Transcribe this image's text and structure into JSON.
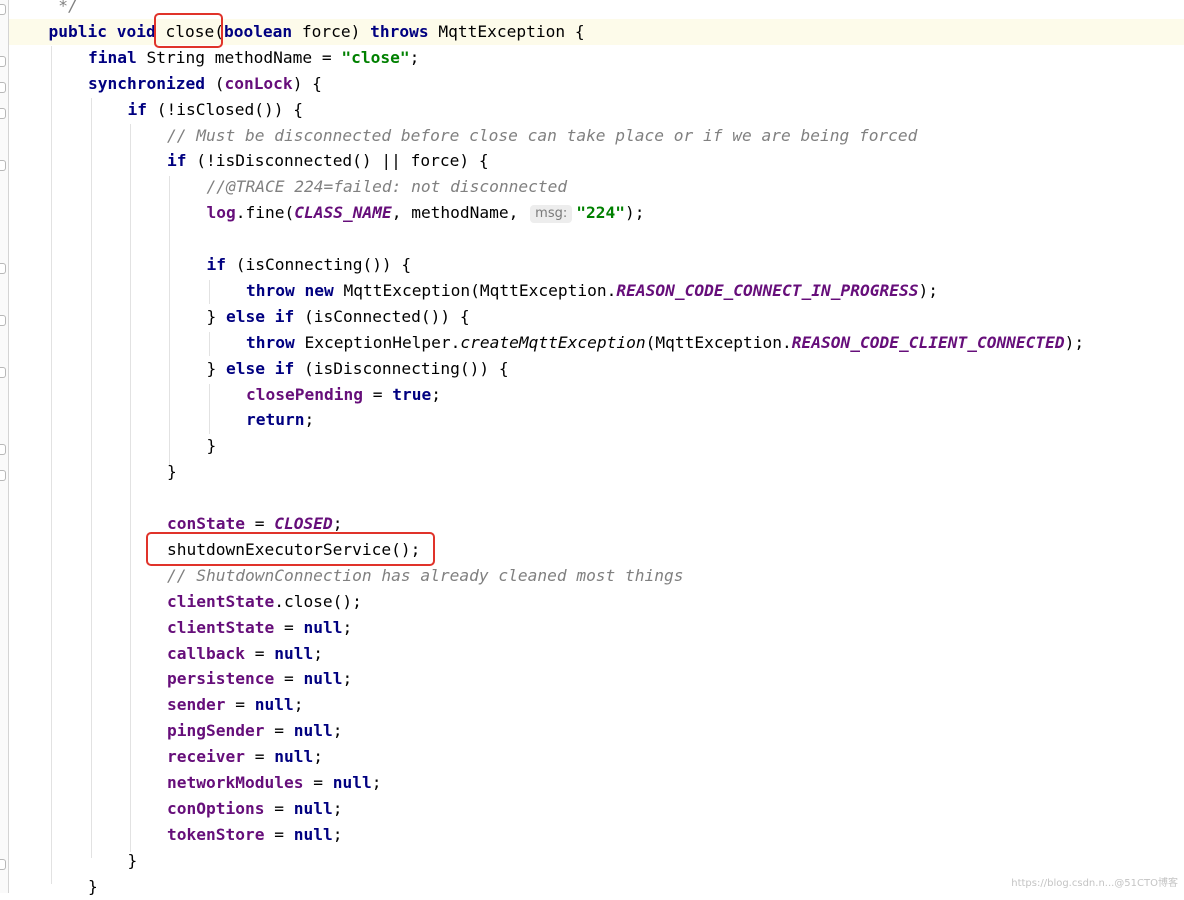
{
  "editor": {
    "lines": [
      {
        "indent": 1,
        "tokens": [
          {
            "t": " */",
            "c": "cmt"
          }
        ]
      },
      {
        "indent": 1,
        "tokens": [
          {
            "t": "public ",
            "c": "kw"
          },
          {
            "t": "void ",
            "c": "kw"
          },
          {
            "t": "close"
          },
          {
            "t": "("
          },
          {
            "t": "boolean",
            "c": "kw"
          },
          {
            "t": " force) "
          },
          {
            "t": "throws ",
            "c": "kw"
          },
          {
            "t": "MqttException {"
          }
        ]
      },
      {
        "indent": 2,
        "tokens": [
          {
            "t": "final ",
            "c": "kw"
          },
          {
            "t": "String methodName = "
          },
          {
            "t": "\"close\"",
            "c": "str"
          },
          {
            "t": ";"
          }
        ]
      },
      {
        "indent": 2,
        "tokens": [
          {
            "t": "synchronized ",
            "c": "kw"
          },
          {
            "t": "("
          },
          {
            "t": "conLock",
            "c": "fld"
          },
          {
            "t": ") {"
          }
        ]
      },
      {
        "indent": 3,
        "tokens": [
          {
            "t": "if ",
            "c": "kw"
          },
          {
            "t": "(!isClosed()) {"
          }
        ]
      },
      {
        "indent": 4,
        "tokens": [
          {
            "t": "// Must be disconnected before close can take place or if we are being forced",
            "c": "cmt"
          }
        ]
      },
      {
        "indent": 4,
        "tokens": [
          {
            "t": "if ",
            "c": "kw"
          },
          {
            "t": "(!isDisconnected() || force) {"
          }
        ]
      },
      {
        "indent": 5,
        "tokens": [
          {
            "t": "//@TRACE 224=failed: not disconnected",
            "c": "cmt"
          }
        ]
      },
      {
        "indent": 5,
        "tokens": [
          {
            "t": "log",
            "c": "fld"
          },
          {
            "t": ".fine("
          },
          {
            "t": "CLASS_NAME",
            "c": "sfld"
          },
          {
            "t": ", methodName, "
          },
          {
            "t": "msg:",
            "c": "hint"
          },
          {
            "t": "\"224\"",
            "c": "str"
          },
          {
            "t": ");"
          }
        ]
      },
      {
        "indent": 5,
        "tokens": []
      },
      {
        "indent": 5,
        "tokens": [
          {
            "t": "if ",
            "c": "kw"
          },
          {
            "t": "(isConnecting()) {"
          }
        ]
      },
      {
        "indent": 6,
        "tokens": [
          {
            "t": "throw new ",
            "c": "kw"
          },
          {
            "t": "MqttException(MqttException."
          },
          {
            "t": "REASON_CODE_CONNECT_IN_PROGRESS",
            "c": "sfld"
          },
          {
            "t": ");"
          }
        ]
      },
      {
        "indent": 5,
        "tokens": [
          {
            "t": "} "
          },
          {
            "t": "else if ",
            "c": "kw"
          },
          {
            "t": "(isConnected()) {"
          }
        ]
      },
      {
        "indent": 6,
        "tokens": [
          {
            "t": "throw ",
            "c": "kw"
          },
          {
            "t": "ExceptionHelper."
          },
          {
            "t": "createMqttException",
            "c": "it"
          },
          {
            "t": "(MqttException."
          },
          {
            "t": "REASON_CODE_CLIENT_CONNECTED",
            "c": "sfld"
          },
          {
            "t": ");"
          }
        ]
      },
      {
        "indent": 5,
        "tokens": [
          {
            "t": "} "
          },
          {
            "t": "else if ",
            "c": "kw"
          },
          {
            "t": "(isDisconnecting()) {"
          }
        ]
      },
      {
        "indent": 6,
        "tokens": [
          {
            "t": "closePending",
            "c": "fld"
          },
          {
            "t": " = "
          },
          {
            "t": "true",
            "c": "kw"
          },
          {
            "t": ";"
          }
        ]
      },
      {
        "indent": 6,
        "tokens": [
          {
            "t": "return",
            "c": "kw"
          },
          {
            "t": ";"
          }
        ]
      },
      {
        "indent": 5,
        "tokens": [
          {
            "t": "}"
          }
        ]
      },
      {
        "indent": 4,
        "tokens": [
          {
            "t": "}"
          }
        ]
      },
      {
        "indent": 4,
        "tokens": []
      },
      {
        "indent": 4,
        "tokens": [
          {
            "t": "conState",
            "c": "fld"
          },
          {
            "t": " = "
          },
          {
            "t": "CLOSED",
            "c": "sfld"
          },
          {
            "t": ";"
          }
        ]
      },
      {
        "indent": 4,
        "tokens": [
          {
            "t": "shutdownExecutorService();"
          }
        ]
      },
      {
        "indent": 4,
        "tokens": [
          {
            "t": "// ShutdownConnection has already cleaned most things",
            "c": "cmt"
          }
        ]
      },
      {
        "indent": 4,
        "tokens": [
          {
            "t": "clientState",
            "c": "fld"
          },
          {
            "t": ".close();"
          }
        ]
      },
      {
        "indent": 4,
        "tokens": [
          {
            "t": "clientState",
            "c": "fld"
          },
          {
            "t": " = "
          },
          {
            "t": "null",
            "c": "kw"
          },
          {
            "t": ";"
          }
        ]
      },
      {
        "indent": 4,
        "tokens": [
          {
            "t": "callback",
            "c": "fld"
          },
          {
            "t": " = "
          },
          {
            "t": "null",
            "c": "kw"
          },
          {
            "t": ";"
          }
        ]
      },
      {
        "indent": 4,
        "tokens": [
          {
            "t": "persistence",
            "c": "fld"
          },
          {
            "t": " = "
          },
          {
            "t": "null",
            "c": "kw"
          },
          {
            "t": ";"
          }
        ]
      },
      {
        "indent": 4,
        "tokens": [
          {
            "t": "sender",
            "c": "fld"
          },
          {
            "t": " = "
          },
          {
            "t": "null",
            "c": "kw"
          },
          {
            "t": ";"
          }
        ]
      },
      {
        "indent": 4,
        "tokens": [
          {
            "t": "pingSender",
            "c": "fld"
          },
          {
            "t": " = "
          },
          {
            "t": "null",
            "c": "kw"
          },
          {
            "t": ";"
          }
        ]
      },
      {
        "indent": 4,
        "tokens": [
          {
            "t": "receiver",
            "c": "fld"
          },
          {
            "t": " = "
          },
          {
            "t": "null",
            "c": "kw"
          },
          {
            "t": ";"
          }
        ]
      },
      {
        "indent": 4,
        "tokens": [
          {
            "t": "networkModules",
            "c": "fld"
          },
          {
            "t": " = "
          },
          {
            "t": "null",
            "c": "kw"
          },
          {
            "t": ";"
          }
        ]
      },
      {
        "indent": 4,
        "tokens": [
          {
            "t": "conOptions",
            "c": "fld"
          },
          {
            "t": " = "
          },
          {
            "t": "null",
            "c": "kw"
          },
          {
            "t": ";"
          }
        ]
      },
      {
        "indent": 4,
        "tokens": [
          {
            "t": "tokenStore",
            "c": "fld"
          },
          {
            "t": " = "
          },
          {
            "t": "null",
            "c": "kw"
          },
          {
            "t": ";"
          }
        ]
      },
      {
        "indent": 3,
        "tokens": [
          {
            "t": "}"
          }
        ]
      },
      {
        "indent": 2,
        "tokens": [
          {
            "t": "}"
          }
        ]
      }
    ]
  },
  "watermark": "https://blog.csdn.n...@51CTO博客",
  "colors": {
    "keyword": "#000080",
    "field": "#660e7a",
    "comment": "#808080",
    "string": "#008000",
    "highlight_box": "#e0332a",
    "current_line": "#fdfbea"
  }
}
